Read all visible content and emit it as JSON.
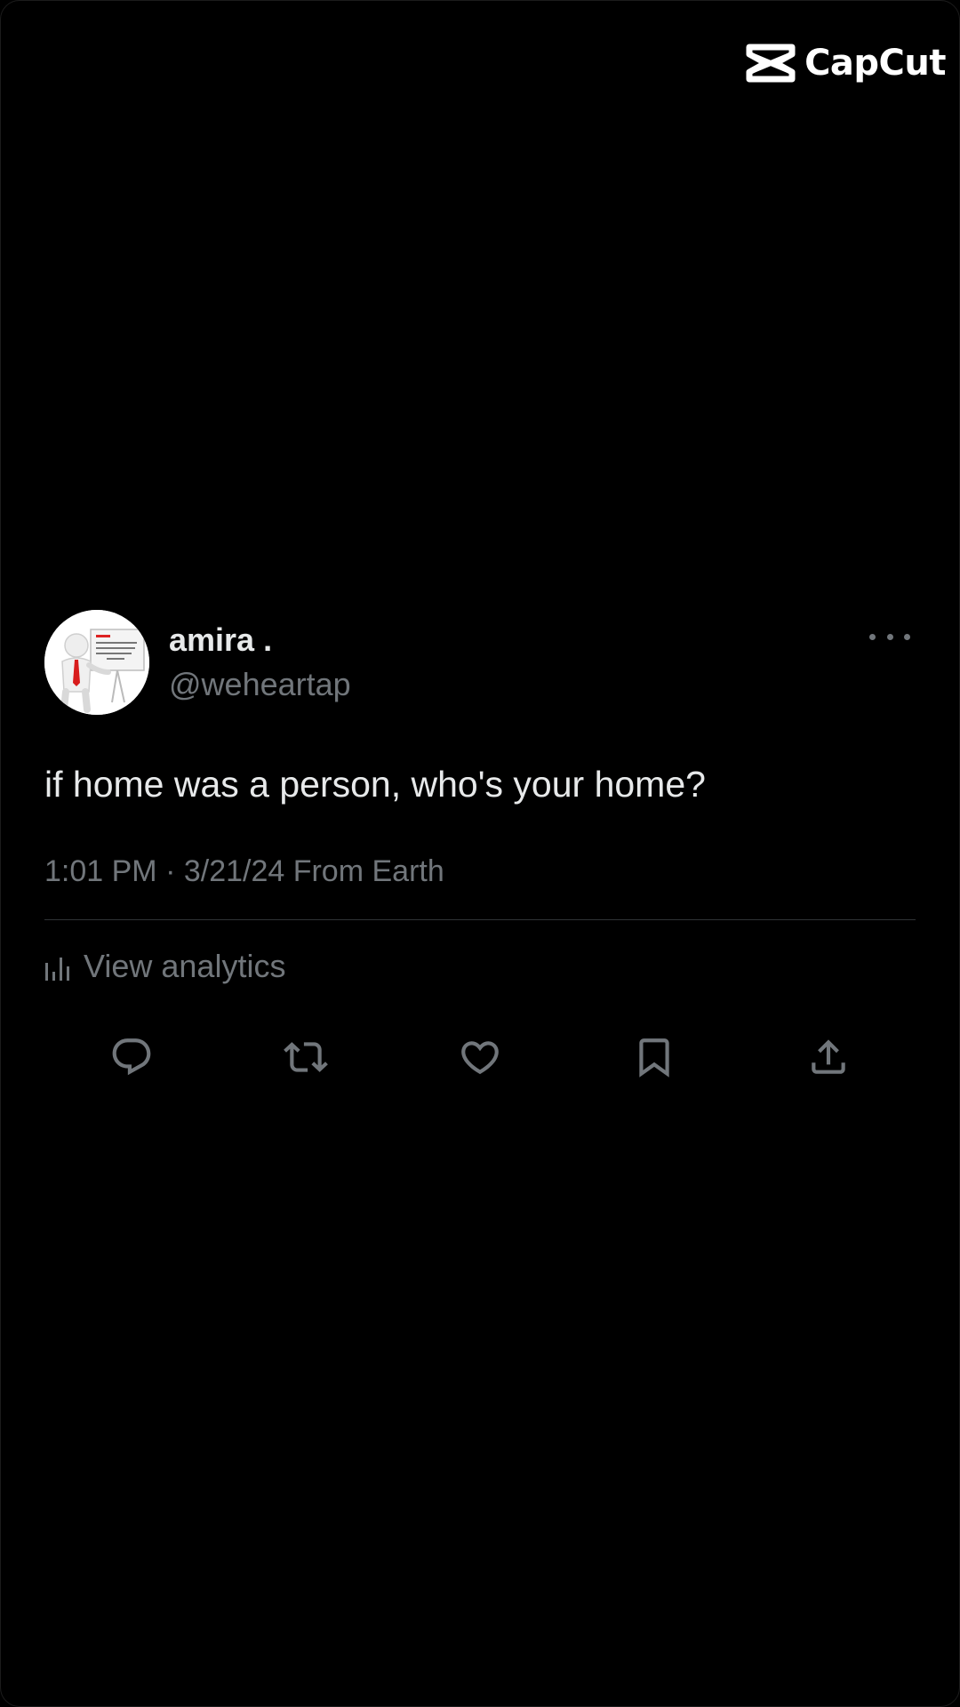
{
  "watermark": {
    "text": "CapCut",
    "icon": "capcut-logo-icon"
  },
  "tweet": {
    "display_name": "amira .",
    "handle": "@weheartap",
    "avatar_icon": "presenter-avatar-icon",
    "more_icon": "more-options-icon",
    "text": "if home was a person, who's your home?",
    "meta": "1:01 PM · 3/21/24 From Earth",
    "analytics_label": "View analytics",
    "analytics_icon": "bar-chart-icon",
    "actions": [
      {
        "name": "reply",
        "icon": "reply-icon"
      },
      {
        "name": "retweet",
        "icon": "retweet-icon"
      },
      {
        "name": "like",
        "icon": "heart-icon"
      },
      {
        "name": "bookmark",
        "icon": "bookmark-icon"
      },
      {
        "name": "share",
        "icon": "share-icon"
      }
    ]
  },
  "colors": {
    "background": "#000000",
    "primary_text": "#e7e9ea",
    "secondary_text": "#71767b",
    "divider": "#2f3336"
  }
}
